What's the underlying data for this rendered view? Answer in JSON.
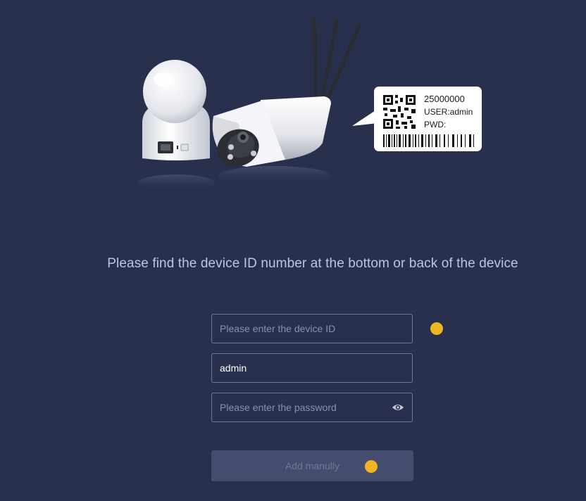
{
  "illustration": {
    "label_id": "25000000",
    "label_user": "USER:admin",
    "label_pwd": "PWD:"
  },
  "instruction": "Please find the device ID number at the bottom or back of the device",
  "form": {
    "device_id": {
      "value": "",
      "placeholder": "Please enter the device ID"
    },
    "username": {
      "value": "admin",
      "placeholder": ""
    },
    "password": {
      "value": "",
      "placeholder": "Please enter the password"
    },
    "submit_label": "Add manully"
  },
  "colors": {
    "background": "#28304d",
    "input_border": "#6f7793",
    "button_bg": "#444d6d",
    "marker": "#efb623"
  },
  "icons": [
    "eye-icon",
    "qr-code-icon",
    "barcode-icon"
  ]
}
